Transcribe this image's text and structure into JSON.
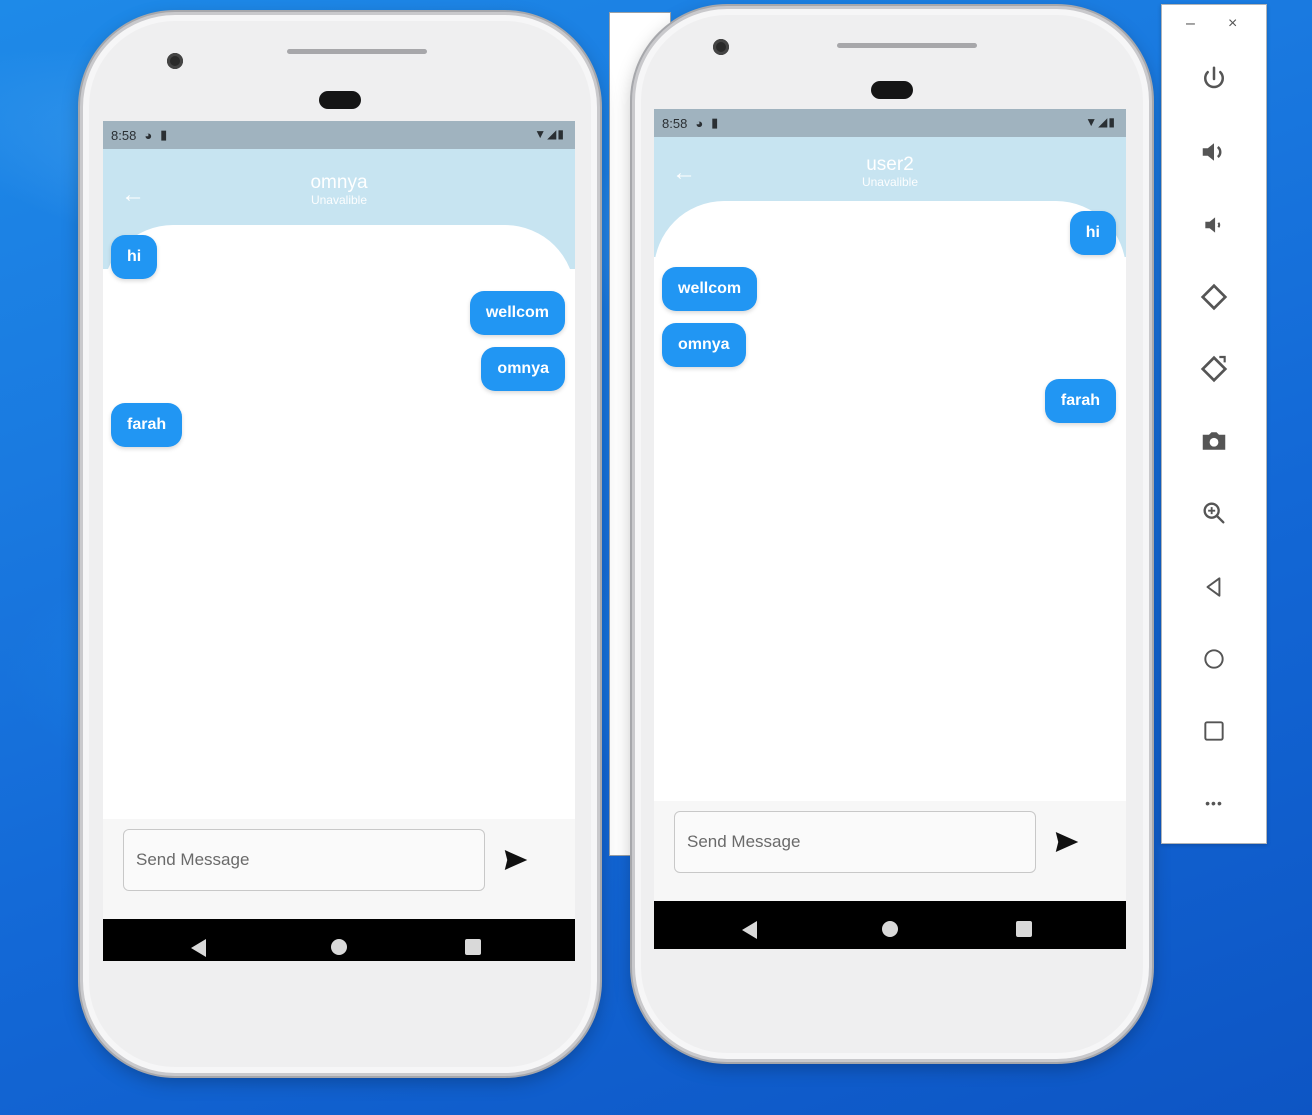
{
  "background_window": {},
  "phones": [
    {
      "status": {
        "time": "8:58"
      },
      "header": {
        "back": "←",
        "title": "omnya",
        "subtitle": "Unavalible"
      },
      "messages": [
        {
          "text": "hi",
          "side": "left"
        },
        {
          "text": "wellcom",
          "side": "right"
        },
        {
          "text": "omnya",
          "side": "right"
        },
        {
          "text": "farah",
          "side": "left"
        }
      ],
      "input": {
        "placeholder": "Send Message"
      }
    },
    {
      "status": {
        "time": "8:58"
      },
      "header": {
        "back": "←",
        "title": "user2",
        "subtitle": "Unavalible"
      },
      "messages": [
        {
          "text": "hi",
          "side": "right"
        },
        {
          "text": "wellcom",
          "side": "left"
        },
        {
          "text": "omnya",
          "side": "left"
        },
        {
          "text": "farah",
          "side": "right"
        }
      ],
      "input": {
        "placeholder": "Send Message"
      }
    }
  ],
  "emulator_toolbar": {
    "minimize": "–",
    "close": "×",
    "tools": [
      "power-icon",
      "volume-up-icon",
      "volume-down-icon",
      "rotate-left-icon",
      "rotate-right-icon",
      "camera-icon",
      "zoom-icon",
      "back-icon",
      "home-icon",
      "overview-icon",
      "more-icon"
    ],
    "more": "•••"
  }
}
